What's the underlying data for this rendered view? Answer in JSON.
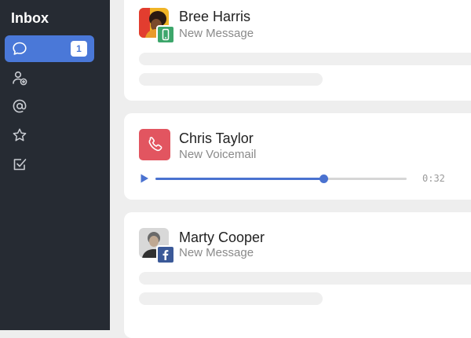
{
  "sidebar": {
    "title": "Inbox",
    "items": [
      {
        "name": "messages",
        "icon": "chat-bubble-icon",
        "badge": "1",
        "active": true
      },
      {
        "name": "contacts",
        "icon": "add-user-icon"
      },
      {
        "name": "mentions",
        "icon": "at-sign-icon"
      },
      {
        "name": "starred",
        "icon": "star-icon"
      },
      {
        "name": "tasks",
        "icon": "checkbox-icon"
      }
    ]
  },
  "messages": [
    {
      "name": "Bree Harris",
      "subtitle": "New Message",
      "channel": "sms",
      "channel_color": "#3da66b"
    },
    {
      "name": "Chris Taylor",
      "subtitle": "New Voicemail",
      "duration": "0:32",
      "progress": 0.67
    },
    {
      "name": "Marty Cooper",
      "subtitle": "New Message",
      "channel": "facebook",
      "channel_color": "#3b5998"
    }
  ],
  "colors": {
    "accent": "#4a78d8",
    "sidebar_bg": "#262b33",
    "voicemail": "#e25560"
  }
}
